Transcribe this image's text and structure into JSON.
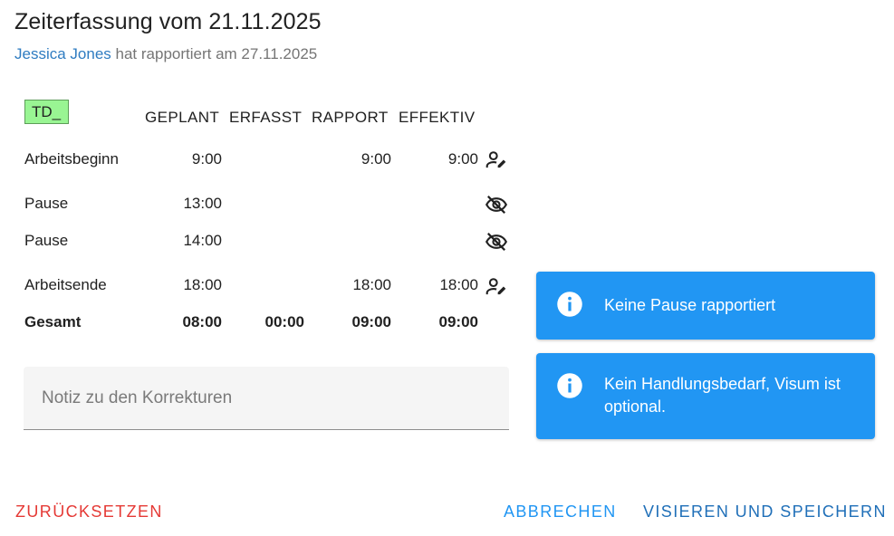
{
  "header": {
    "title": "Zeiterfassung vom 21.11.2025",
    "user": "Jessica Jones",
    "reported_text": "hat rapportiert am 27.11.2025"
  },
  "tag": "TD_",
  "columns": {
    "geplant": "GEPLANT",
    "erfasst": "ERFASST",
    "rapport": "RAPPORT",
    "effektiv": "EFFEKTIV"
  },
  "rows": [
    {
      "label": "Arbeitsbeginn",
      "geplant": "9:00",
      "erfasst": "",
      "rapport": "9:00",
      "effektiv": "9:00",
      "icon": "person-edit-icon"
    },
    {
      "label": "Pause",
      "geplant": "13:00",
      "erfasst": "",
      "rapport": "",
      "effektiv": "",
      "icon": "eye-off-icon"
    },
    {
      "label": "Pause",
      "geplant": "14:00",
      "erfasst": "",
      "rapport": "",
      "effektiv": "",
      "icon": "eye-off-icon"
    },
    {
      "label": "Arbeitsende",
      "geplant": "18:00",
      "erfasst": "",
      "rapport": "18:00",
      "effektiv": "18:00",
      "icon": "person-edit-icon"
    }
  ],
  "total": {
    "label": "Gesamt",
    "geplant": "08:00",
    "erfasst": "00:00",
    "rapport": "09:00",
    "effektiv": "09:00"
  },
  "note": {
    "placeholder": "Notiz zu den Korrekturen",
    "value": ""
  },
  "alerts": [
    {
      "text": "Keine Pause rapportiert",
      "icon": "info-icon"
    },
    {
      "text": "Kein Handlungsbedarf, Visum ist optional.",
      "icon": "info-icon"
    }
  ],
  "actions": {
    "reset": "ZURÜCKSETZEN",
    "cancel": "ABBRECHEN",
    "save": "VISIEREN UND SPEICHERN"
  },
  "colors": {
    "primary": "#2196f3",
    "link": "#2f7cc1",
    "danger": "#e53935",
    "tag_bg": "#99f593"
  }
}
